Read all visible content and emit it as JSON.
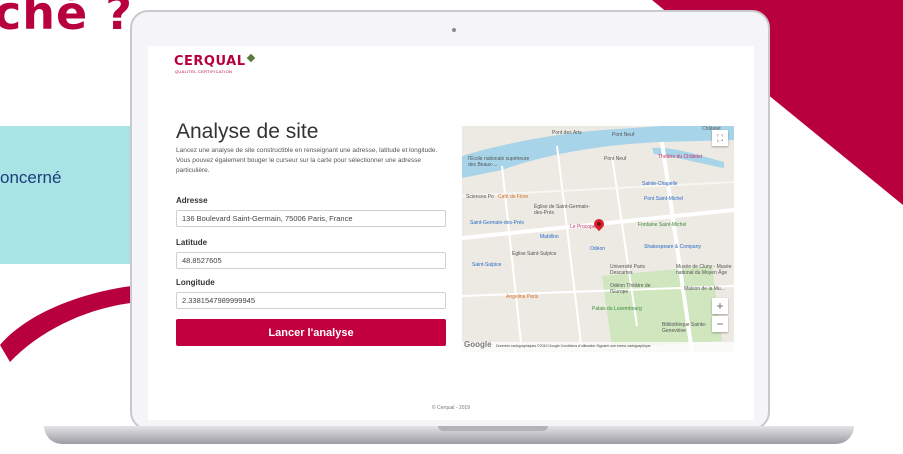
{
  "background": {
    "title": "ché ?",
    "side_text": "oncerné"
  },
  "app": {
    "logo": "CERQUAL",
    "logo_sub": "QUALITEL CERTIFICATION",
    "title": "Analyse de site",
    "description": "Lancez une analyse de site constructible en renseignant une adresse, latitude et longitude. Vous pouvez également bouger le curseur sur la carte pour sélectionner une adresse particulière.",
    "address": {
      "label": "Adresse",
      "value": "136 Boulevard Saint-Germain, 75006 Paris, France"
    },
    "latitude": {
      "label": "Latitude",
      "value": "48.8527605"
    },
    "longitude": {
      "label": "Longitude",
      "value": "2.3381547989999945"
    },
    "submit_label": "Lancer l'analyse",
    "footer": "© Cerqual - 2019"
  },
  "map": {
    "fullscreen_icon": "fullscreen-icon",
    "zoom_in": "+",
    "zoom_out": "−",
    "google": "Google",
    "attribution": "Données cartographiques ©2019 Google   Conditions d'utilisation   Signaler une erreur cartographique",
    "labels": {
      "pont_des_arts": "Pont des Arts",
      "pont_neuf": "Pont Neuf",
      "chatelet": "Châtelet",
      "ecole": "l'École nationale supérieure des Beaux-...",
      "pont_neuf2": "Pont Neuf",
      "theatre": "Théâtre du Châtelet",
      "sciences_po": "Sciences Po",
      "cafe_flore": "Café de Flore",
      "eglise_sg": "Église de Saint-Germain-des-Prés",
      "sainte_chapelle": "Sainte-Chapelle",
      "pont_saint_michel": "Pont Saint-Michel",
      "saint_germain": "Saint-Germain-des-Prés",
      "le_procope": "Le Procope",
      "fontaine": "Fontaine Saint-Michel",
      "mabillon": "Mabillon",
      "odeon": "Odéon",
      "shakespeare": "Shakespeare & Company",
      "eglise_ss": "Église Saint-Sulpice",
      "saint_sulpice": "Saint-Sulpice",
      "universite": "Université Paris Descartes",
      "musee_cluny": "Musée de Cluny - Musée national du Moyen Âge",
      "odeon_theatre": "Odéon Théâtre de l'Europe",
      "maison": "Maison de la Mu...",
      "angelina": "Angelina Paris",
      "palais": "Palais du Luxembourg",
      "bibliotheque": "Bibliothèque Sainte-Geneviève"
    }
  },
  "colors": {
    "brand": "#c2003f",
    "teal": "#a8e3e6",
    "map_water": "#a8d4ea",
    "map_park": "#cfe6bf"
  }
}
